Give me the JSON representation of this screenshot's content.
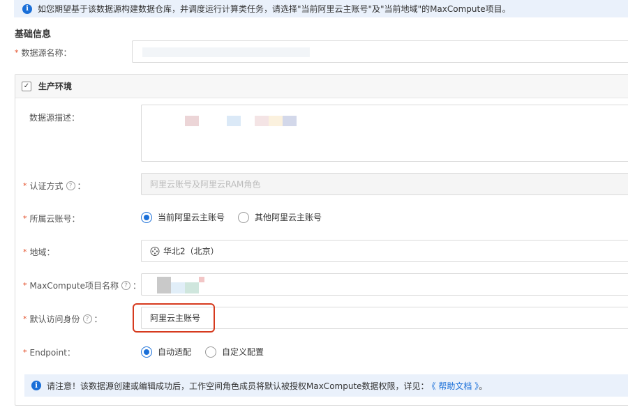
{
  "banner": {
    "text": "如您期望基于该数据源构建数据仓库，并调度运行计算类任务，请选择\"当前阿里云主账号\"及\"当前地域\"的MaxCompute项目。"
  },
  "basic_info": {
    "title": "基础信息"
  },
  "fields": {
    "ds_name_label": "数据源名称：",
    "env_title": "生产环境",
    "desc_label": "数据源描述：",
    "auth_label": "认证方式",
    "auth_value": "阿里云账号及阿里云RAM角色",
    "account_label": "所属云账号：",
    "account_opt1": "当前阿里云主账号",
    "account_opt2": "其他阿里云主账号",
    "region_label": "地域：",
    "region_value": "华北2（北京）",
    "project_label": "MaxCompute项目名称",
    "identity_label": "默认访问身份",
    "identity_value": "阿里云主账号",
    "endpoint_label": "Endpoint：",
    "endpoint_opt1": "自动适配",
    "endpoint_opt2": "自定义配置",
    "colon": "："
  },
  "note": {
    "text": "请注意！该数据源创建或编辑成功后，工作空间角色成员将默认被授权MaxCompute数据权限，详见：",
    "link": "《 帮助文档 》",
    "end": "。"
  },
  "colors": {
    "accent": "#1a6fd8",
    "required": "#e34d27",
    "highlight": "#d63a1e"
  },
  "icons": {
    "info": "info-icon",
    "help": "question-circle-icon",
    "region": "globe-icon",
    "check": "checkbox-icon"
  }
}
